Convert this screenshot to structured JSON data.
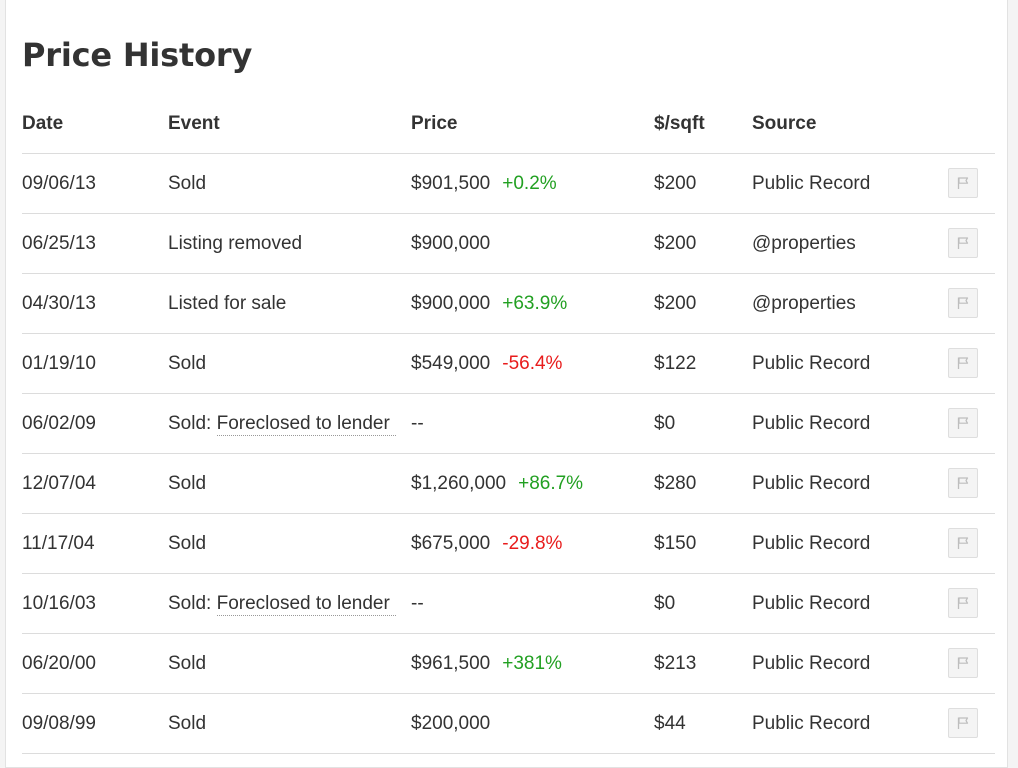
{
  "title": "Price History",
  "columns": {
    "date": "Date",
    "event": "Event",
    "price": "Price",
    "sqft": "$/sqft",
    "source": "Source"
  },
  "colors": {
    "increase": "#22a022",
    "decrease": "#e81c1c"
  },
  "flag_icon": "flag-icon",
  "rows": [
    {
      "date": "09/06/13",
      "event": "Sold",
      "event_detail": "",
      "price": "$901,500",
      "change": "+0.2%",
      "change_dir": "up",
      "sqft": "$200",
      "source": "Public Record"
    },
    {
      "date": "06/25/13",
      "event": "Listing removed",
      "event_detail": "",
      "price": "$900,000",
      "change": "",
      "change_dir": "",
      "sqft": "$200",
      "source": "@properties"
    },
    {
      "date": "04/30/13",
      "event": "Listed for sale",
      "event_detail": "",
      "price": "$900,000",
      "change": "+63.9%",
      "change_dir": "up",
      "sqft": "$200",
      "source": "@properties"
    },
    {
      "date": "01/19/10",
      "event": "Sold",
      "event_detail": "",
      "price": "$549,000",
      "change": "-56.4%",
      "change_dir": "down",
      "sqft": "$122",
      "source": "Public Record"
    },
    {
      "date": "06/02/09",
      "event": "Sold:",
      "event_detail": "Foreclosed to lender",
      "price": "--",
      "change": "",
      "change_dir": "",
      "sqft": "$0",
      "source": "Public Record"
    },
    {
      "date": "12/07/04",
      "event": "Sold",
      "event_detail": "",
      "price": "$1,260,000",
      "change": "+86.7%",
      "change_dir": "up",
      "sqft": "$280",
      "source": "Public Record"
    },
    {
      "date": "11/17/04",
      "event": "Sold",
      "event_detail": "",
      "price": "$675,000",
      "change": "-29.8%",
      "change_dir": "down",
      "sqft": "$150",
      "source": "Public Record"
    },
    {
      "date": "10/16/03",
      "event": "Sold:",
      "event_detail": "Foreclosed to lender",
      "price": "--",
      "change": "",
      "change_dir": "",
      "sqft": "$0",
      "source": "Public Record"
    },
    {
      "date": "06/20/00",
      "event": "Sold",
      "event_detail": "",
      "price": "$961,500",
      "change": "+381%",
      "change_dir": "up",
      "sqft": "$213",
      "source": "Public Record"
    },
    {
      "date": "09/08/99",
      "event": "Sold",
      "event_detail": "",
      "price": "$200,000",
      "change": "",
      "change_dir": "",
      "sqft": "$44",
      "source": "Public Record"
    }
  ]
}
